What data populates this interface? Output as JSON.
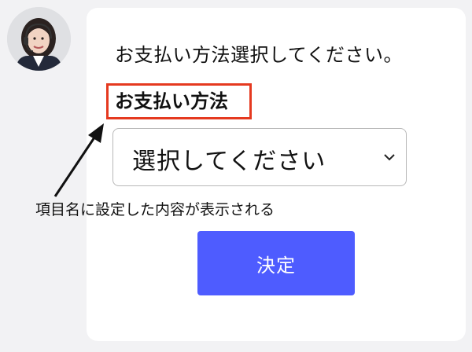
{
  "chat": {
    "avatar_icon": "operator-headset-avatar",
    "prompt": "お支払い方法選択してください。"
  },
  "form": {
    "field_label": "お支払い方法",
    "select_value": "選択してください",
    "submit_label": "決定"
  },
  "annotation": {
    "text": "項目名に設定した内容が表示される",
    "highlight_color": "#e5391f"
  },
  "colors": {
    "background": "#f2f2f4",
    "card": "#ffffff",
    "button": "#4e5cff"
  }
}
